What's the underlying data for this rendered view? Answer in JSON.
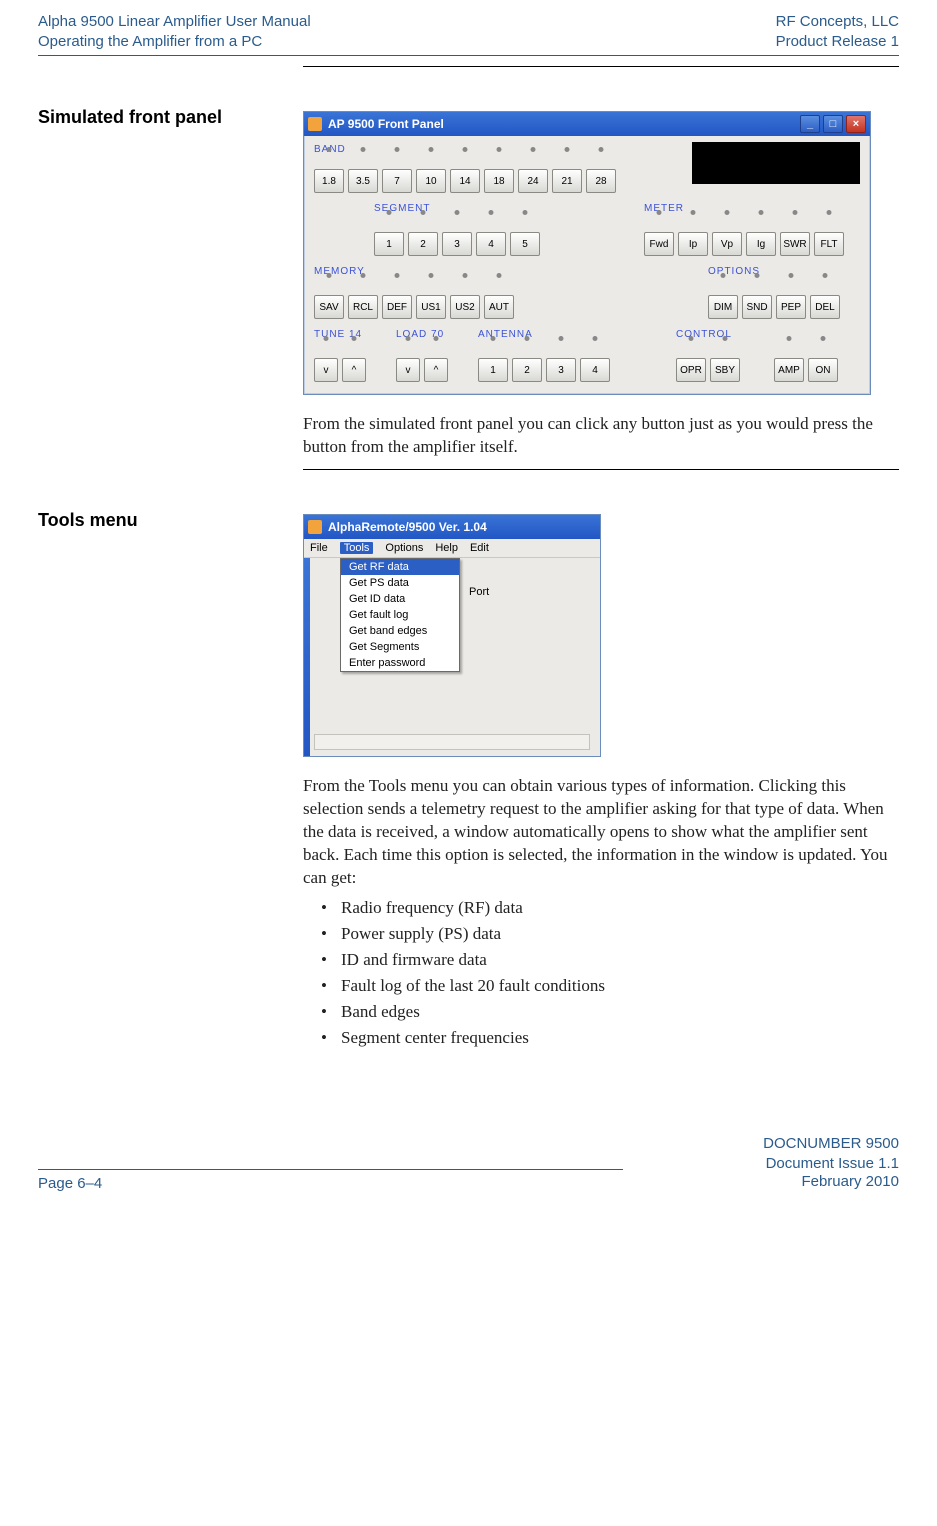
{
  "header": {
    "left1": "Alpha 9500 Linear Amplifier User Manual",
    "left2": "Operating the Amplifier from a PC",
    "right1": "RF Concepts, LLC",
    "right2": "Product Release 1"
  },
  "sections": {
    "simulated_front_panel": {
      "heading": "Simulated front panel",
      "caption": "From the simulated front panel you can click any button just as you would press the button from the amplifier itself."
    },
    "tools_menu": {
      "heading": "Tools menu",
      "caption": "From the Tools menu you can obtain various types of information. Clicking this selection sends a telemetry request to the amplifier asking for that type of data. When the data is received, a window automatically opens to show what the amplifier sent back. Each time this option is selected, the information in the window is updated. You can get:",
      "bullets": [
        "Radio frequency (RF) data",
        "Power supply (PS) data",
        "ID and firmware data",
        "Fault log of the last 20 fault conditions",
        "Band edges",
        "Segment center frequencies"
      ]
    }
  },
  "front_panel": {
    "title": "AP 9500 Front Panel",
    "groups": {
      "band": {
        "label": "BAND",
        "buttons": [
          "1.8",
          "3.5",
          "7",
          "10",
          "14",
          "18",
          "24",
          "21",
          "28"
        ]
      },
      "segment": {
        "label": "SEGMENT",
        "buttons": [
          "1",
          "2",
          "3",
          "4",
          "5"
        ]
      },
      "meter": {
        "label": "METER",
        "buttons": [
          "Fwd",
          "Ip",
          "Vp",
          "Ig",
          "SWR",
          "FLT"
        ]
      },
      "memory": {
        "label": "MEMORY",
        "buttons": [
          "SAV",
          "RCL",
          "DEF",
          "US1",
          "US2",
          "AUT"
        ]
      },
      "options": {
        "label": "OPTIONS",
        "buttons": [
          "DIM",
          "SND",
          "PEP",
          "DEL"
        ]
      },
      "tune": {
        "label": "TUNE 14",
        "buttons": [
          "v",
          "^"
        ]
      },
      "load": {
        "label": "LOAD 70",
        "buttons": [
          "v",
          "^"
        ]
      },
      "antenna": {
        "label": "ANTENNA",
        "buttons": [
          "1",
          "2",
          "3",
          "4"
        ]
      },
      "control": {
        "label": "CONTROL",
        "buttons": [
          "OPR",
          "SBY",
          "AMP",
          "ON"
        ]
      }
    }
  },
  "tools_window": {
    "title": "AlphaRemote/9500 Ver. 1.04",
    "menubar": [
      "File",
      "Tools",
      "Options",
      "Help",
      "Edit"
    ],
    "selected_menu": "Tools",
    "dropdown": [
      "Get RF data",
      "Get PS data",
      "Get ID data",
      "Get fault log",
      "Get band edges",
      "Get Segments",
      "Enter password"
    ],
    "dropdown_selected": "Get RF data",
    "background_label": "Port"
  },
  "footer": {
    "doc": "DOCNUMBER 9500",
    "issue": "Document Issue 1.1",
    "date": "February 2010",
    "page": "Page 6–4"
  }
}
